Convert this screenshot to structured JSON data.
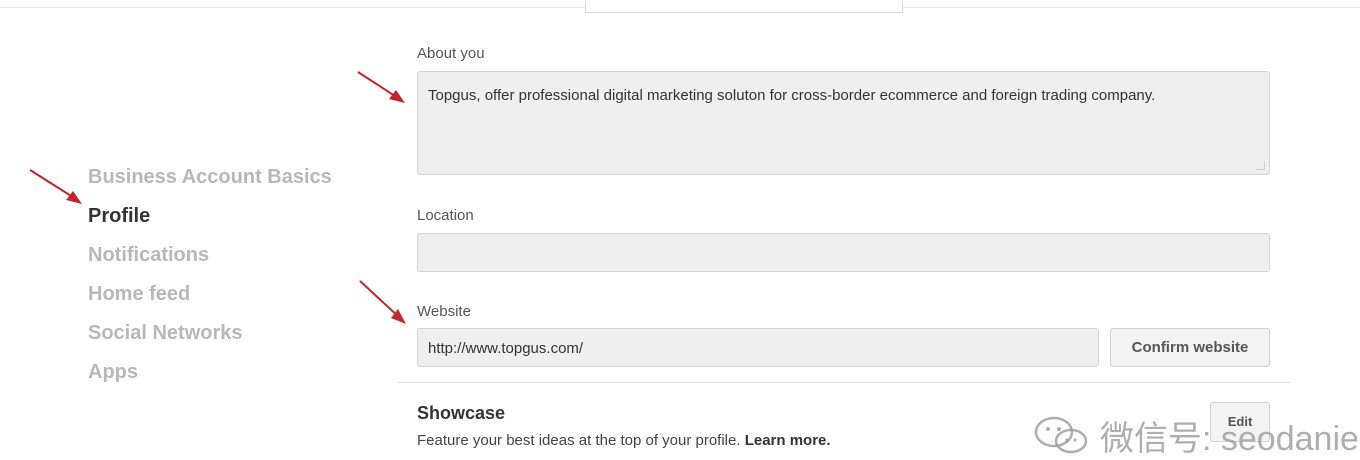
{
  "sidebar": {
    "items": [
      {
        "label": "Business Account Basics"
      },
      {
        "label": "Profile"
      },
      {
        "label": "Notifications"
      },
      {
        "label": "Home feed"
      },
      {
        "label": "Social Networks"
      },
      {
        "label": "Apps"
      }
    ],
    "active": "Profile"
  },
  "about": {
    "label": "About you",
    "value": "Topgus, offer professional digital marketing soluton for cross-border ecommerce and foreign trading company."
  },
  "location": {
    "label": "Location",
    "value": ""
  },
  "website": {
    "label": "Website",
    "value": "http://www.topgus.com/",
    "confirm_label": "Confirm website"
  },
  "showcase": {
    "title": "Showcase",
    "description": "Feature your best ideas at the top of your profile.",
    "learn_more": "Learn more.",
    "edit_label": "Edit"
  },
  "watermark": {
    "text": "微信号: seodanie"
  },
  "colors": {
    "arrow": "#c0262c",
    "field_bg": "#efefef",
    "inactive_nav": "#b8b8b8"
  },
  "icons": [
    "red-arrow-icon",
    "wechat-icon"
  ]
}
